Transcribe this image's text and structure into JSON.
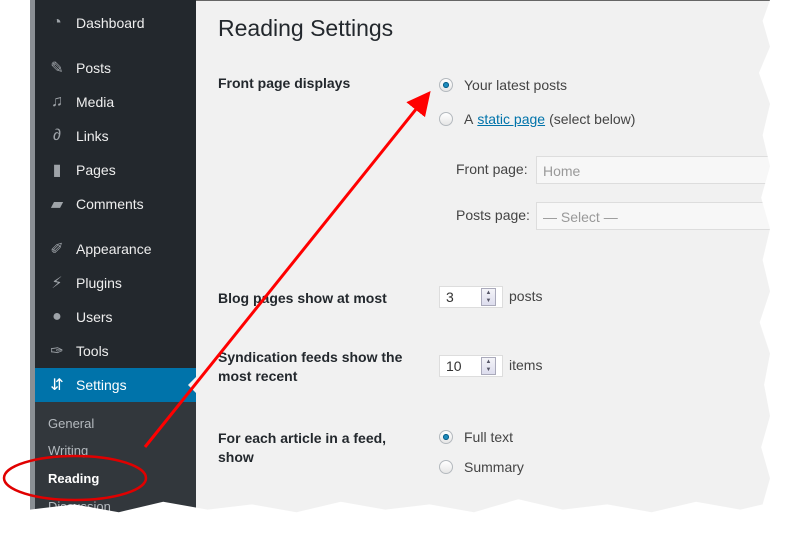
{
  "sidebar": {
    "items": [
      {
        "label": "Dashboard",
        "icon": "dashboard-icon"
      },
      {
        "label": "Posts",
        "icon": "pin-icon"
      },
      {
        "label": "Media",
        "icon": "media-icon"
      },
      {
        "label": "Links",
        "icon": "link-icon"
      },
      {
        "label": "Pages",
        "icon": "pages-icon"
      },
      {
        "label": "Comments",
        "icon": "comment-icon"
      },
      {
        "label": "Appearance",
        "icon": "brush-icon"
      },
      {
        "label": "Plugins",
        "icon": "plug-icon"
      },
      {
        "label": "Users",
        "icon": "user-icon"
      },
      {
        "label": "Tools",
        "icon": "wrench-icon"
      },
      {
        "label": "Settings",
        "icon": "settings-icon",
        "active": true
      }
    ],
    "submenu": [
      {
        "label": "General"
      },
      {
        "label": "Writing"
      },
      {
        "label": "Reading",
        "current": true
      },
      {
        "label": "Discussion"
      }
    ]
  },
  "page": {
    "title": "Reading Settings",
    "front_page_displays": {
      "label": "Front page displays",
      "option_latest": "Your latest posts",
      "option_static_prefix": "A",
      "option_static_link": "static page",
      "option_static_suffix": "(select below)",
      "selected": "latest",
      "front_page_label": "Front page:",
      "front_page_value": "Home",
      "posts_page_label": "Posts page:",
      "posts_page_value": "— Select —"
    },
    "blog_pages": {
      "label": "Blog pages show at most",
      "value": "3",
      "unit": "posts"
    },
    "syndication": {
      "label": "Syndication feeds show the most recent",
      "value": "10",
      "unit": "items"
    },
    "feed_article": {
      "label": "For each article in a feed, show",
      "option_full": "Full text",
      "option_summary": "Summary",
      "selected": "full"
    }
  },
  "annotation": {
    "color": "#ff0000"
  }
}
